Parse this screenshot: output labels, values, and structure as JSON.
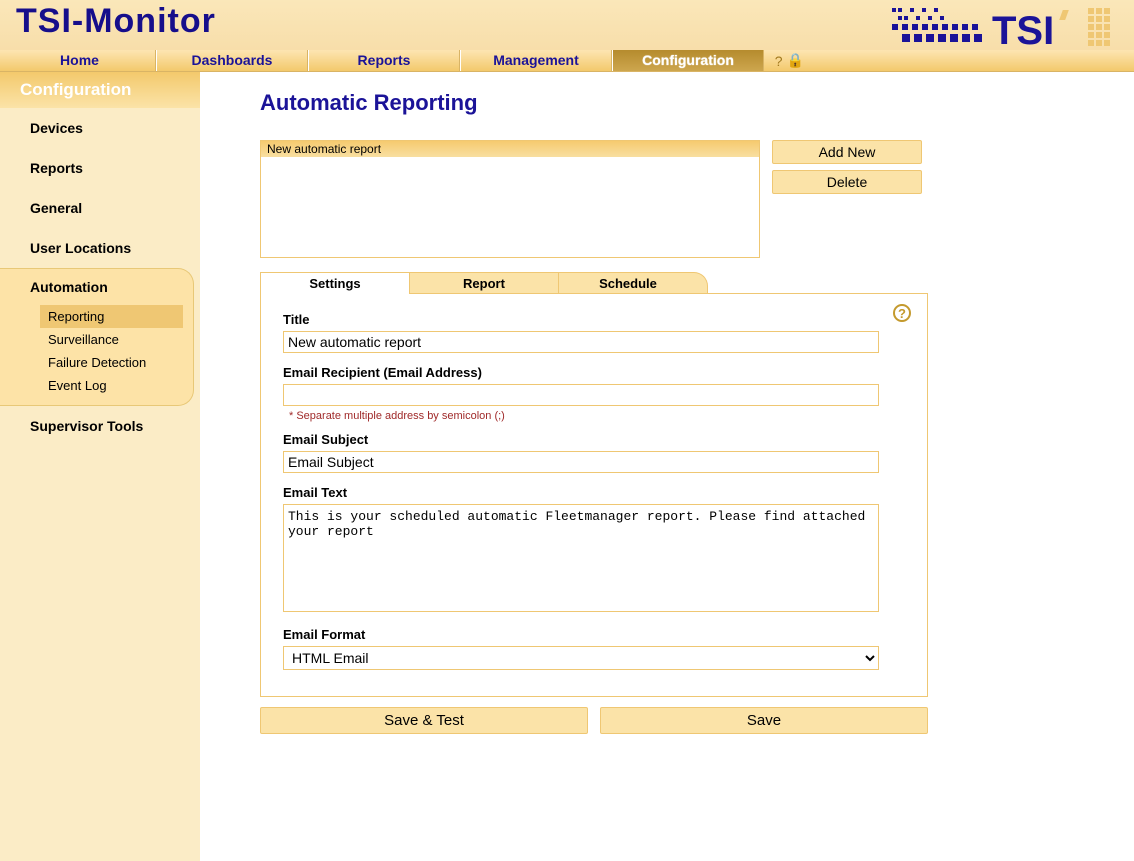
{
  "app": {
    "title": "TSI-Monitor"
  },
  "nav": {
    "items": [
      {
        "label": "Home"
      },
      {
        "label": "Dashboards"
      },
      {
        "label": "Reports"
      },
      {
        "label": "Management"
      },
      {
        "label": "Configuration",
        "active": true
      }
    ],
    "help_icon": "?",
    "lock_icon": "🔒"
  },
  "sidebar": {
    "title": "Configuration",
    "items": [
      {
        "label": "Devices"
      },
      {
        "label": "Reports"
      },
      {
        "label": "General"
      },
      {
        "label": "User Locations"
      },
      {
        "label": "Automation",
        "expanded": true,
        "children": [
          {
            "label": "Reporting",
            "selected": true
          },
          {
            "label": "Surveillance"
          },
          {
            "label": "Failure Detection"
          },
          {
            "label": "Event Log"
          }
        ]
      },
      {
        "label": "Supervisor Tools"
      }
    ]
  },
  "page": {
    "title": "Automatic Reporting",
    "report_list": [
      "New automatic report"
    ],
    "add_new_btn": "Add New",
    "delete_btn": "Delete",
    "tabs": [
      {
        "label": "Settings",
        "active": true
      },
      {
        "label": "Report"
      },
      {
        "label": "Schedule"
      }
    ],
    "form": {
      "title_label": "Title",
      "title_value": "New automatic report",
      "recipient_label": "Email Recipient (Email Address)",
      "recipient_value": "",
      "recipient_hint": "* Separate multiple address by semicolon (;)",
      "subject_label": "Email Subject",
      "subject_value": "Email Subject",
      "text_label": "Email Text",
      "text_value": "This is your scheduled automatic Fleetmanager report. Please find attached your report",
      "format_label": "Email Format",
      "format_value": "HTML Email",
      "format_options": [
        "HTML Email"
      ]
    },
    "save_test_btn": "Save & Test",
    "save_btn": "Save",
    "help_tooltip": "?"
  }
}
